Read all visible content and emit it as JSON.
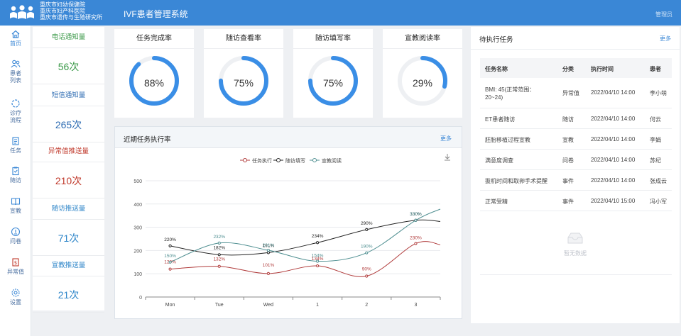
{
  "header": {
    "hospitals": [
      "重庆市妇幼保健院",
      "重庆市妇产科医院",
      "重庆市遗传与生殖研究所"
    ],
    "app_title": "IVF患者管理系统",
    "right_label": "管理员"
  },
  "sidebar": {
    "items": [
      {
        "label": "首页",
        "icon": "home-icon"
      },
      {
        "label": "患者\n列表",
        "icon": "patients-icon"
      },
      {
        "label": "诊疗\n流程",
        "icon": "flow-icon"
      },
      {
        "label": "任务",
        "icon": "task-icon"
      },
      {
        "label": "随访",
        "icon": "followup-icon"
      },
      {
        "label": "宣教",
        "icon": "education-icon"
      },
      {
        "label": "问卷",
        "icon": "survey-icon"
      },
      {
        "label": "异常值",
        "icon": "abnormal-icon"
      },
      {
        "label": "设置",
        "icon": "gear-icon"
      }
    ]
  },
  "stats": [
    {
      "label": "电话通知量",
      "value": "56次",
      "color": "#3c9a4a"
    },
    {
      "label": "短信通知量",
      "value": "265次",
      "color": "#2f6db3"
    },
    {
      "label": "异常值推送量",
      "value": "210次",
      "color": "#c0392b"
    },
    {
      "label": "随访推送量",
      "value": "71次",
      "color": "#2f86c9"
    },
    {
      "label": "宣教推送量",
      "value": "21次",
      "color": "#2f86c9"
    }
  ],
  "gauges": [
    {
      "title": "任务完成率",
      "percent": 88,
      "label": "88%"
    },
    {
      "title": "随访查看率",
      "percent": 75,
      "label": "75%"
    },
    {
      "title": "随访填写率",
      "percent": 75,
      "label": "75%"
    },
    {
      "title": "宣教阅读率",
      "percent": 29,
      "label": "29%"
    }
  ],
  "chart_card": {
    "title": "近期任务执行率",
    "more": "更多"
  },
  "chart_data": {
    "type": "line",
    "categories": [
      "Mon",
      "Tue",
      "Wed",
      "1",
      "2",
      "3"
    ],
    "ylim": [
      0,
      500
    ],
    "yticks": [
      0,
      100,
      200,
      300,
      400,
      500
    ],
    "legend_position": "top",
    "series": [
      {
        "name": "任务执行",
        "color": "#b03a3a",
        "values": [
          120,
          132,
          101,
          134,
          90,
          230
        ],
        "labels": [
          "120%",
          "132%",
          "101%",
          "134%",
          "90%",
          "230%"
        ],
        "extra_end": 225
      },
      {
        "name": "随访填写",
        "color": "#222222",
        "values": [
          220,
          182,
          191,
          234,
          290,
          330
        ],
        "labels": [
          "220%",
          "182%",
          "191%",
          "234%",
          "290%",
          "330%"
        ],
        "extra_end": 325
      },
      {
        "name": "宣教阅读",
        "color": "#4f8f91",
        "values": [
          150,
          232,
          201,
          154,
          190,
          330
        ],
        "labels": [
          "150%",
          "232%",
          "201%",
          "154%",
          "190%",
          "330%"
        ],
        "extra_end": 378
      }
    ]
  },
  "tasks": {
    "title": "待执行任务",
    "more": "更多",
    "columns": [
      "任务名称",
      "分类",
      "执行时间",
      "患者"
    ],
    "rows": [
      {
        "name": "BMI: 45(正常范围：20~24)",
        "name_line1": "BMI: 45(正常范围：",
        "name_line2": "20~24)",
        "type": "异常值",
        "time": "2022/04/10 14:00",
        "patient": "李小萌"
      },
      {
        "name": "ET患者随访",
        "type": "随访",
        "time": "2022/04/10 14:00",
        "patient": "何云"
      },
      {
        "name": "胚胎移植过程宣教",
        "type": "宣教",
        "time": "2022/04/10 14:00",
        "patient": "李娟"
      },
      {
        "name": "满意度调查",
        "type": "问卷",
        "time": "2022/04/10 14:00",
        "patient": "苏纪"
      },
      {
        "name": "扳机时间和取卵手术提醒",
        "type": "事件",
        "time": "2022/04/10 14:00",
        "patient": "张成云"
      },
      {
        "name": "正常受精",
        "type": "事件",
        "time": "2022/04/10 15:00",
        "patient": "冯小军"
      }
    ],
    "empty_text": "暂无数据"
  }
}
